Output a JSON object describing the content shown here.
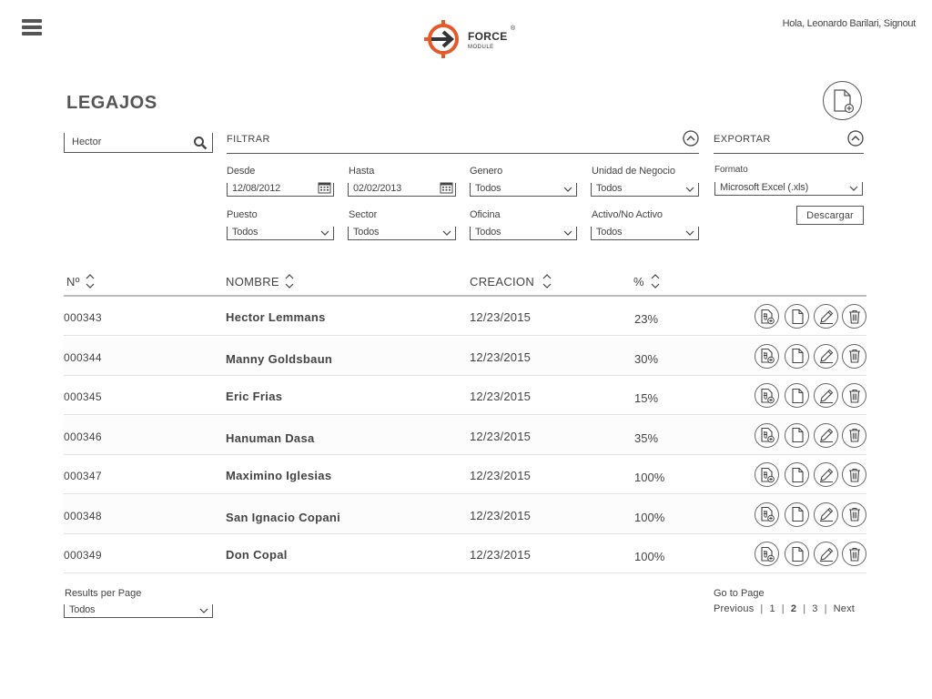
{
  "header": {
    "brand_name": "FORCE",
    "brand_sub": "MODULE",
    "brand_reg": "®",
    "greeting": "Hola, Leonardo Barilari, Signout",
    "accent_color": "#e45a2a"
  },
  "page": {
    "title": "LEGAJOS"
  },
  "search": {
    "value": "Hector"
  },
  "filter": {
    "title": "FILTRAR",
    "desde": {
      "label": "Desde",
      "value": "12/08/2012"
    },
    "hasta": {
      "label": "Hasta",
      "value": "02/02/2013"
    },
    "genero": {
      "label": "Genero",
      "value": "Todos"
    },
    "unidad": {
      "label": "Unidad de Negocio",
      "value": "Todos"
    },
    "puesto": {
      "label": "Puesto",
      "value": "Todos"
    },
    "sector": {
      "label": "Sector",
      "value": "Todos"
    },
    "oficina": {
      "label": "Oficina",
      "value": "Todos"
    },
    "activo": {
      "label": "Activo/No Activo",
      "value": "Todos"
    }
  },
  "export": {
    "title": "EXPORTAR",
    "format_label": "Formato",
    "format_value": "Microsoft Excel (.xls)",
    "download_label": "Descargar"
  },
  "table": {
    "headers": {
      "num": "Nº",
      "name": "NOMBRE",
      "created": "CREACION",
      "pct": "%"
    },
    "rows": [
      {
        "num": "000343",
        "name": "Hector Lemmans",
        "created": "12/23/2015",
        "pct": "23%"
      },
      {
        "num": "000344",
        "name": "Manny Goldsbaun",
        "created": "12/23/2015",
        "pct": "30%"
      },
      {
        "num": "000345",
        "name": "Eric Frias",
        "created": "12/23/2015",
        "pct": "15%"
      },
      {
        "num": "000346",
        "name": "Hanuman Dasa",
        "created": "12/23/2015",
        "pct": "35%"
      },
      {
        "num": "000347",
        "name": "Maximino Iglesias",
        "created": "12/23/2015",
        "pct": "100%"
      },
      {
        "num": "000348",
        "name": "San Ignacio Copani",
        "created": "12/23/2015",
        "pct": "100%"
      },
      {
        "num": "000349",
        "name": "Don Copal",
        "created": "12/23/2015",
        "pct": "100%"
      }
    ],
    "row_actions": [
      "attach-document-icon",
      "document-icon",
      "edit-pencil-icon",
      "trash-icon"
    ]
  },
  "pagination": {
    "results_label": "Results per Page",
    "results_value": "Todos",
    "goto_label": "Go to Page",
    "previous": "Previous",
    "pages": [
      "1",
      "2",
      "3"
    ],
    "current": "2",
    "next": "Next",
    "separator": "|"
  }
}
